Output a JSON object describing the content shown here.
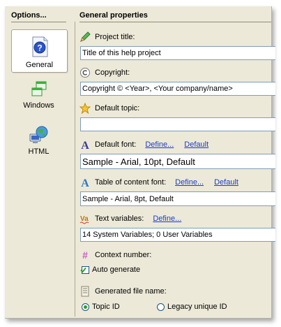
{
  "options": {
    "title": "Options...",
    "items": [
      {
        "label": "General",
        "icon": "help-book-icon",
        "selected": true
      },
      {
        "label": "Windows",
        "icon": "windows-icon",
        "selected": false
      },
      {
        "label": "HTML",
        "icon": "globe-computer-icon",
        "selected": false
      }
    ]
  },
  "general": {
    "title": "General properties",
    "project_title": {
      "label": "Project title:",
      "value": "Title of this help project",
      "icon": "pencil-icon"
    },
    "copyright": {
      "label": "Copyright:",
      "value": "Copyright © <Year>, <Your company/name>",
      "icon": "copyright-icon"
    },
    "default_topic": {
      "label": "Default topic:",
      "value": "",
      "icon": "star-icon"
    },
    "default_font": {
      "label": "Default font:",
      "define": "Define...",
      "default": "Default",
      "value": "Sample - Arial, 10pt, Default",
      "icon": "font-icon"
    },
    "toc_font": {
      "label": "Table of content font:",
      "define": "Define...",
      "default": "Default",
      "value": "Sample - Arial, 8pt, Default",
      "icon": "font-icon"
    },
    "text_variables": {
      "label": "Text variables:",
      "define": "Define...",
      "value": "14 System Variables; 0 User Variables",
      "icon": "variables-icon"
    },
    "context_number": {
      "label": "Context number:",
      "icon": "hash-icon",
      "auto_generate": "Auto generate",
      "checked": true
    },
    "generated_file_name": {
      "label": "Generated file name:",
      "icon": "document-icon",
      "options": [
        "Topic ID",
        "Legacy unique ID"
      ],
      "selected": "Topic ID"
    }
  },
  "colors": {
    "link": "#1a3fc6",
    "panel": "#ece9d8",
    "field_border": "#7f9db9"
  }
}
